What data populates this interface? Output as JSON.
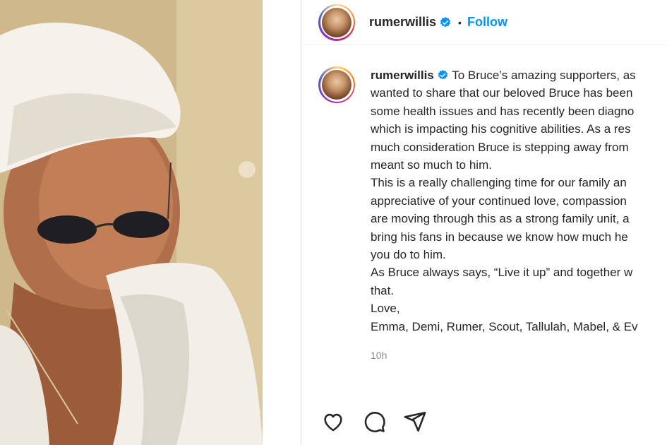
{
  "photo": {
    "alt_subject": ""
  },
  "header": {
    "username": "rumerwillis",
    "separator": "•",
    "follow_label": "Follow"
  },
  "post": {
    "username": "rumerwillis",
    "lines": [
      "To Bruce’s amazing supporters, as",
      "wanted to share that our beloved Bruce has been",
      "some health issues and has recently been diagno",
      "which is impacting his cognitive abilities. As a res",
      "much consideration Bruce is stepping away from",
      "meant so much to him.",
      "This is a really challenging time for our family an",
      "appreciative of your continued love, compassion",
      "are moving through this as a strong family unit, a",
      "bring his fans in because we know how much he",
      "you do to him.",
      "As Bruce always says, “Live it up” and together w",
      "that.",
      "Love,",
      "Emma, Demi, Rumer, Scout, Tallulah, Mabel, & Ev"
    ],
    "timestamp": "10h"
  },
  "icons": {
    "verified": "verified-badge-icon",
    "like": "heart-icon",
    "comment": "comment-icon",
    "share": "share-icon"
  },
  "colors": {
    "accent": "#0095f6",
    "text": "#262626",
    "muted": "#8e8e8e",
    "border": "#dbdbdb"
  }
}
